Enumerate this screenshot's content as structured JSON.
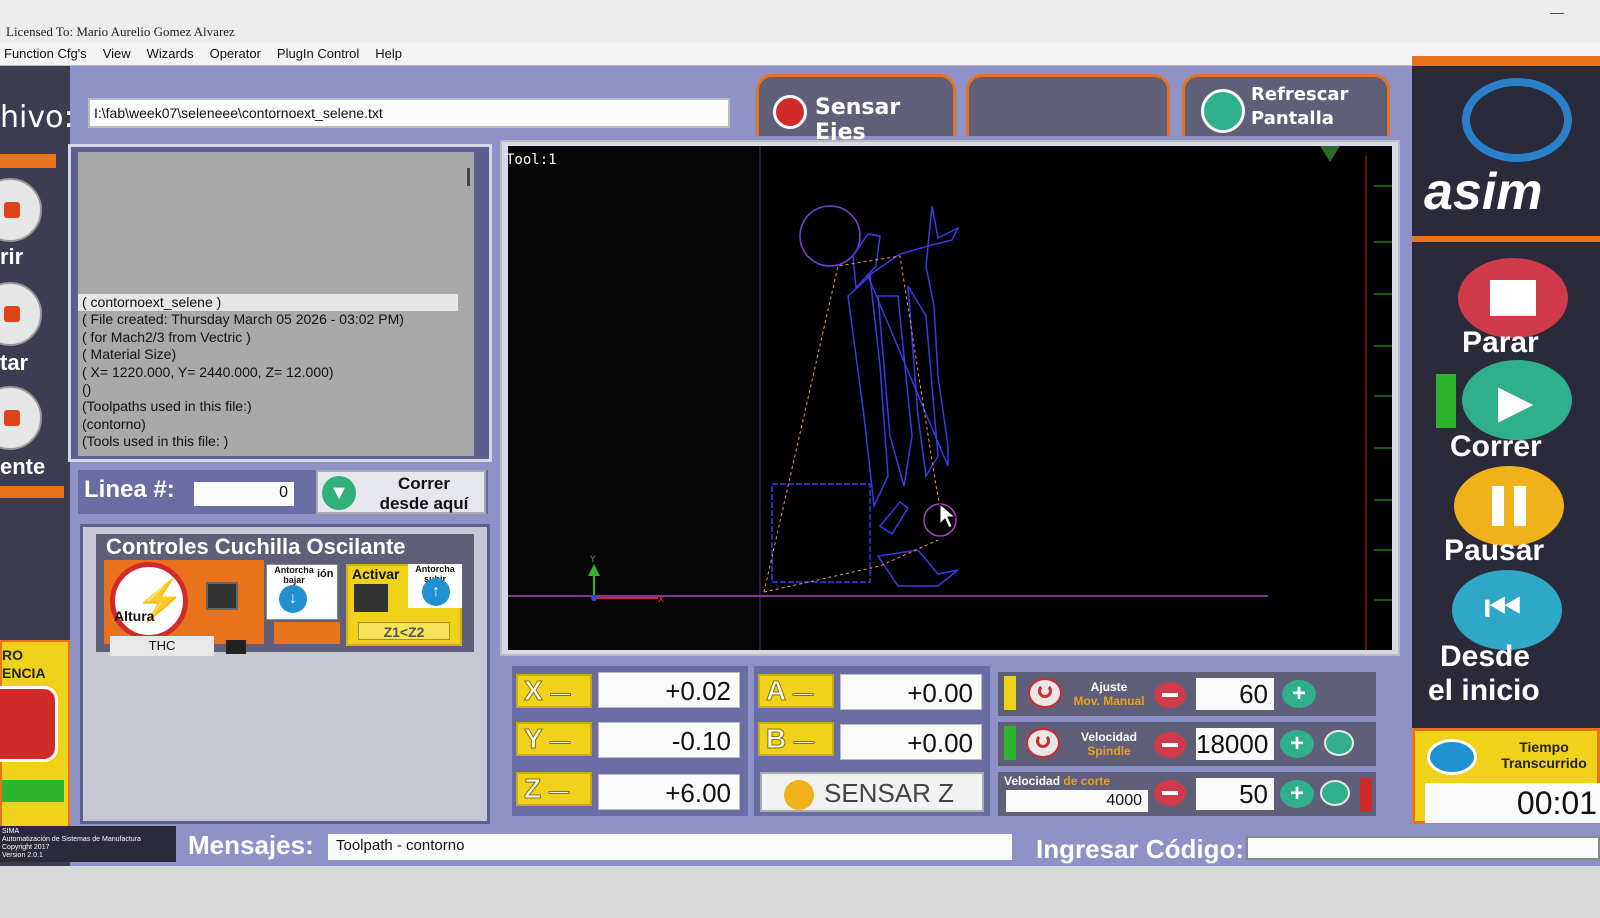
{
  "titlebar": {
    "license": "Licensed To: Mario Aurelio Gomez Alvarez"
  },
  "menu": [
    "Function Cfg's",
    "View",
    "Wizards",
    "Operator",
    "PlugIn Control",
    "Help"
  ],
  "file": {
    "label": "hivo:",
    "path": "I:\\fab\\week07\\seleneee\\contornoext_selene.txt"
  },
  "gcode": {
    "lines": [
      "( contornoext_selene )",
      "( File created: Thursday March 05 2026 - 03:02 PM)",
      "( for Mach2/3 from Vectric )",
      "( Material Size)",
      "( X= 1220.000, Y= 2440.000, Z= 12.000)",
      "()",
      "(Toolpaths used in this file:)",
      "(contorno)",
      "(Tools used in this file: )"
    ]
  },
  "linea": {
    "label": "Linea #:",
    "value": "0"
  },
  "correr_desde": {
    "line1": "Correr",
    "line2": "desde aquí"
  },
  "left_buttons": {
    "b1": "rir",
    "b2": "tar",
    "b3": "ente",
    "emergency": "RO\nENCIA"
  },
  "controles": {
    "title": "Controles Cuchilla Oscilante",
    "altura": "Altura",
    "thc": "THC",
    "antorcha_bajar": "Antorcha bajar",
    "ion": "ión",
    "activar": "Activar",
    "antorcha_subir": "Antorcha subir",
    "z1z2": "Z1<Z2"
  },
  "tabs": {
    "sensar_ejes": "Sensar Ejes",
    "refrescar_1": "Refrescar",
    "refrescar_2": "Pantalla"
  },
  "toolpath": {
    "tool_label": "Tool:1"
  },
  "dro": {
    "x": {
      "label": "X",
      "value": "+0.02"
    },
    "y": {
      "label": "Y",
      "value": "-0.10"
    },
    "z": {
      "label": "Z",
      "value": "+6.00"
    },
    "a": {
      "label": "A",
      "value": "+0.00"
    },
    "b": {
      "label": "B",
      "value": "+0.00"
    },
    "sensar_z": "SENSAR Z"
  },
  "speeds": {
    "ajuste": {
      "label1": "Ajuste",
      "label2": "Mov. Manual",
      "value": "60"
    },
    "velocidad_spindle": {
      "label1": "Velocidad",
      "label2": "Spindle",
      "value": "18000"
    },
    "velocidad_corte": {
      "label1": "Velocidad",
      "label2": "de corte",
      "sub_value": "4000",
      "value": "50"
    }
  },
  "messages": {
    "label": "Mensajes:",
    "text": "Toolpath - contorno",
    "ingresar_label": "Ingresar Código:"
  },
  "company": {
    "line1": "SIMA",
    "line2": "Automatización de Sistemas de Manufactura",
    "line3": "Copyright 2017",
    "line4": "Version 2.0.1"
  },
  "right": {
    "logo_text": "asim",
    "parar": "Parar",
    "correr": "Correr",
    "pausar": "Pausar",
    "desde_1": "Desde",
    "desde_2": "el inicio",
    "tiempo_1": "Tiempo",
    "tiempo_2": "Transcurrido",
    "tiempo_val": "00:01"
  },
  "colors": {
    "panel": "#8f92c7",
    "accent_orange": "#e8731c",
    "accent_yellow": "#f0d21a",
    "toolpath_blue": "#3a3ae8",
    "rapid_orange": "#e8a060"
  }
}
